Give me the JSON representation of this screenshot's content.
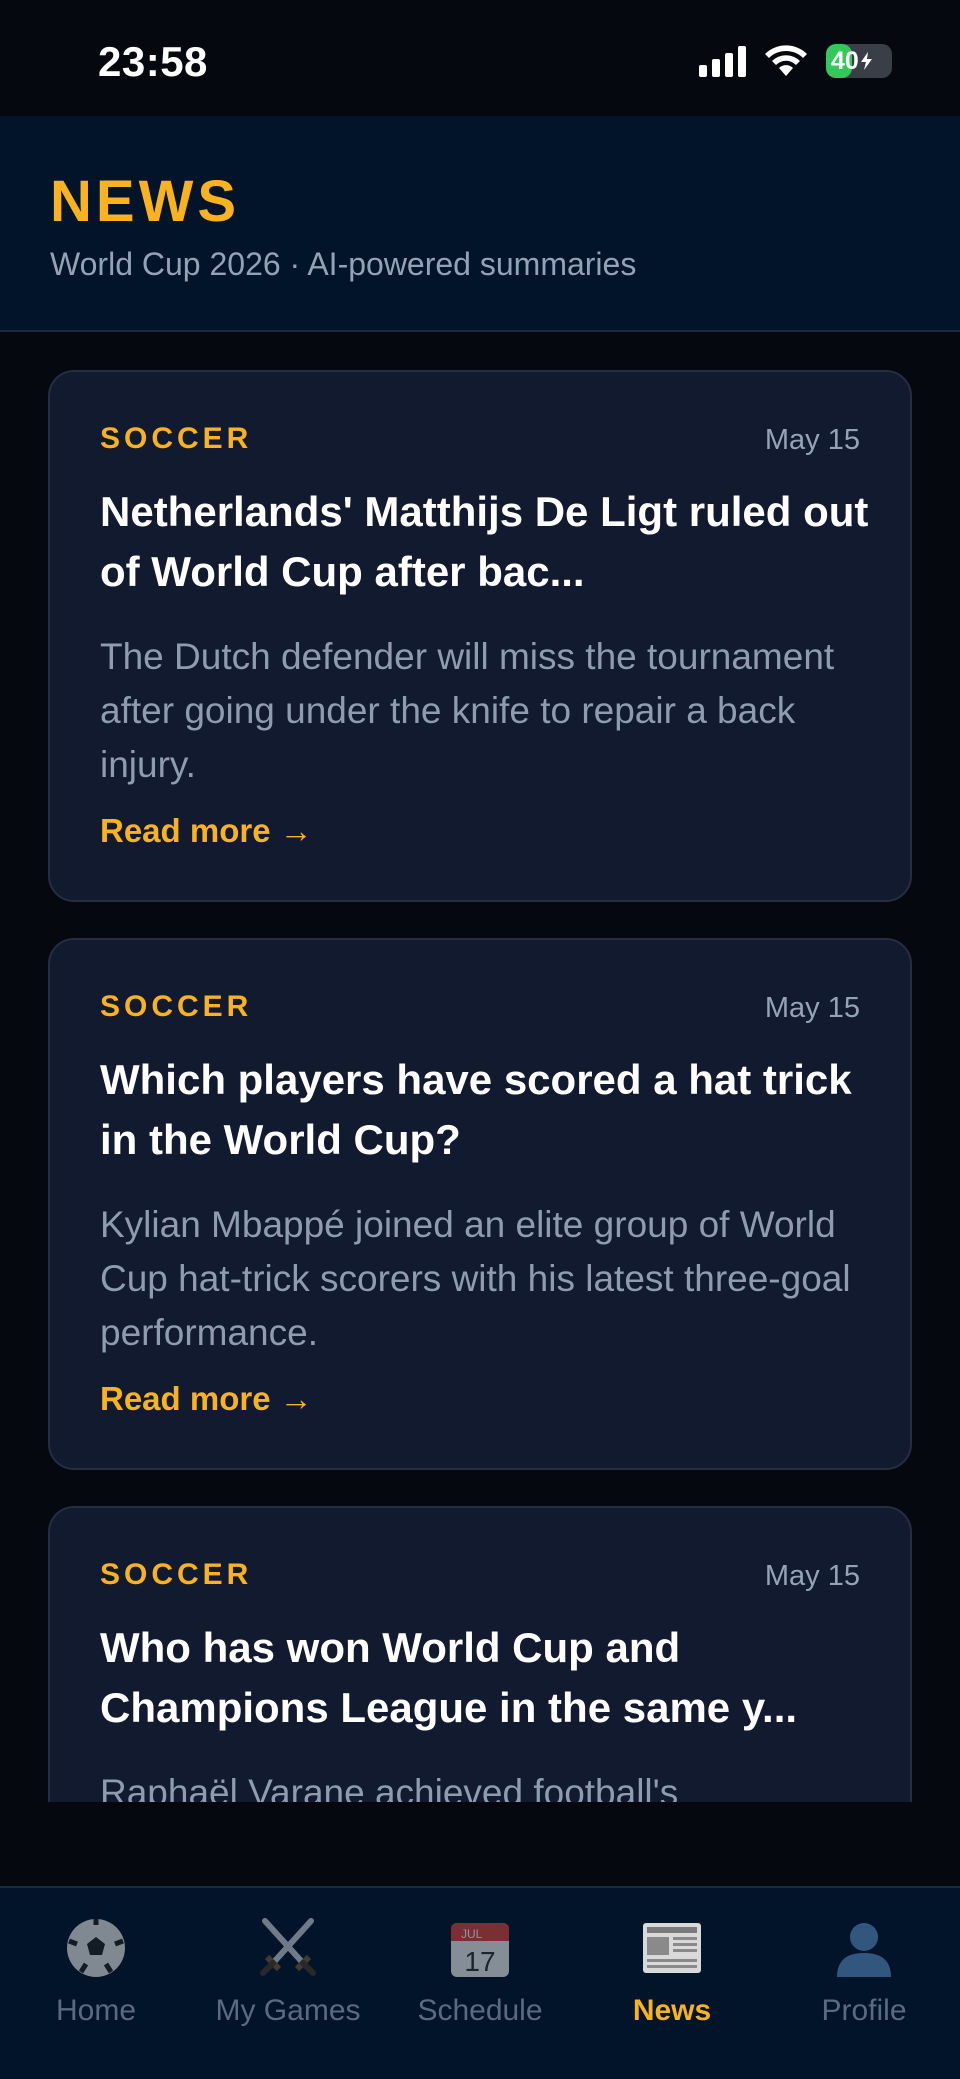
{
  "status_bar": {
    "time": "23:58",
    "battery": "40"
  },
  "header": {
    "title": "NEWS",
    "subtitle": "World Cup 2026 · AI-powered summaries"
  },
  "articles": [
    {
      "category": "SOCCER",
      "date": "May 15",
      "title": "Netherlands' Matthijs De Ligt ruled out of World Cup after bac...",
      "summary": "The Dutch defender will miss the tournament after going under the knife to repair a back injury.",
      "link": "Read more →"
    },
    {
      "category": "SOCCER",
      "date": "May 15",
      "title": "Which players have scored a hat trick in the World Cup?",
      "summary": "Kylian Mbappé joined an elite group of World Cup hat-trick scorers with his latest three-goal performance.",
      "link": "Read more →"
    },
    {
      "category": "SOCCER",
      "date": "May 15",
      "title": "Who has won World Cup and Champions League in the same y...",
      "summary": "Raphaël Varane achieved football's",
      "link": ""
    }
  ],
  "tabs": [
    {
      "label": "Home",
      "icon": "soccer-ball-icon",
      "active": false
    },
    {
      "label": "My Games",
      "icon": "crossed-swords-icon",
      "active": false
    },
    {
      "label": "Schedule",
      "icon": "calendar-icon",
      "active": false,
      "icon_text": {
        "month": "JUL",
        "day": "17"
      }
    },
    {
      "label": "News",
      "icon": "newspaper-icon",
      "active": true
    },
    {
      "label": "Profile",
      "icon": "person-icon",
      "active": false
    }
  ],
  "colors": {
    "accent": "#fbb220",
    "background": "#05080e",
    "header_bg": "#021429",
    "card_bg": "#111a2e"
  }
}
